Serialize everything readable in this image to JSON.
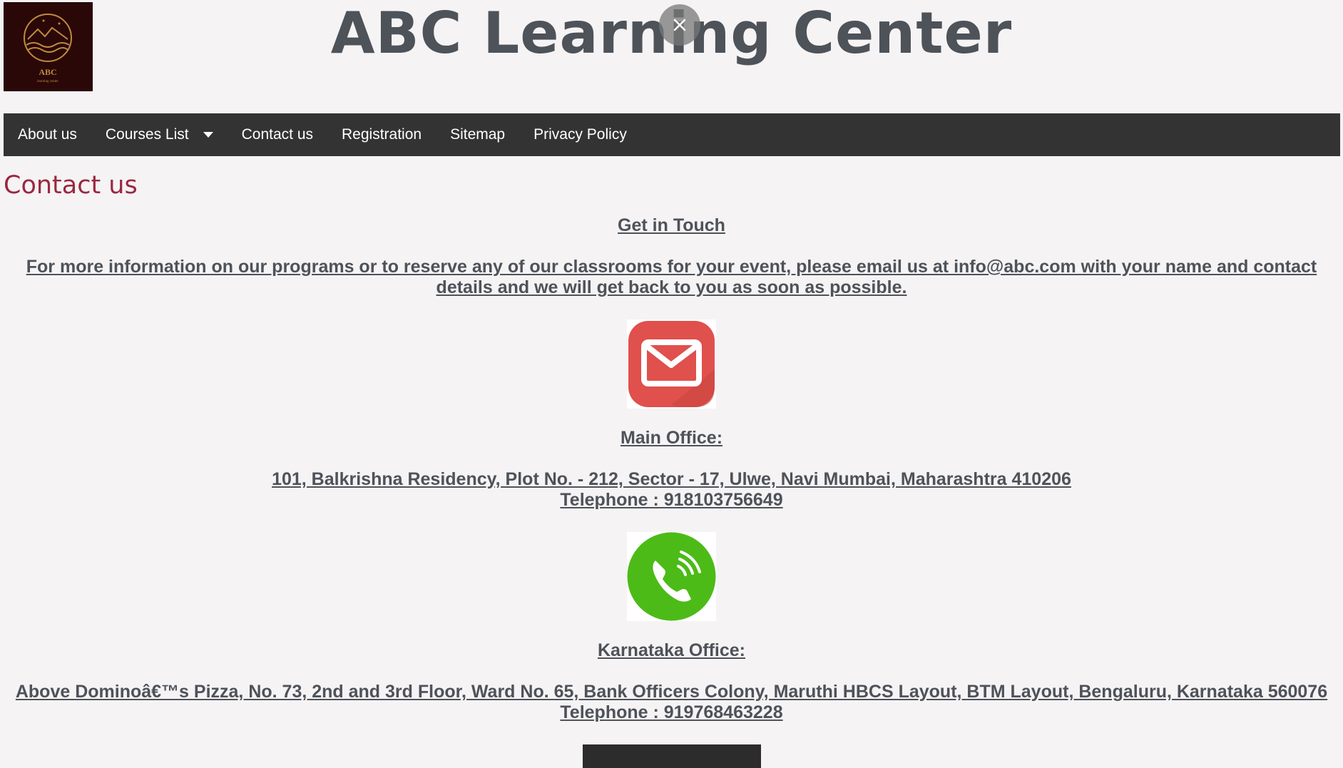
{
  "header": {
    "site_title": "ABC Learning Center",
    "logo_text": "ABC",
    "logo_subtext": "learning center"
  },
  "close_label": "×",
  "nav": {
    "items": [
      {
        "label": "About us"
      },
      {
        "label": "Courses List"
      },
      {
        "label": "Contact us"
      },
      {
        "label": "Registration"
      },
      {
        "label": "Sitemap"
      },
      {
        "label": "Privacy Policy"
      }
    ]
  },
  "main": {
    "heading": "Contact us",
    "get_in_touch": "Get in Touch",
    "info_line1": "For more information on our programs or to reserve any of our classrooms for your event, please email us at info@abc.com with your name and contact",
    "info_line2": "details and we will get back to you as soon as possible.",
    "main_office_title": "Main Office:",
    "main_office_address": "101, Balkrishna Residency, Plot No. - 212, Sector - 17, Ulwe, Navi Mumbai, Maharashtra 410206",
    "main_office_phone": "Telephone : 918103756649",
    "karnataka_office_title": "Karnataka Office:",
    "karnataka_office_address": "Above Dominoâ€™s Pizza, No. 73, 2nd and 3rd Floor, Ward No. 65, Bank Officers Colony, Maruthi HBCS Layout, BTM Layout, Bengaluru, Karnataka 560076",
    "karnataka_office_phone": "Telephone : 919768463228"
  },
  "icons": {
    "email": "email-icon",
    "phone": "phone-icon",
    "close": "close-icon",
    "dropdown": "chevron-down-icon"
  },
  "colors": {
    "background": "#f5f3f4",
    "nav_bg": "#333333",
    "heading": "#9b2740",
    "text": "#4e5259",
    "email_icon": "#e0504c",
    "phone_icon": "#4cbb17",
    "logo_bg": "#2a0808",
    "logo_gold": "#c08a3e"
  }
}
